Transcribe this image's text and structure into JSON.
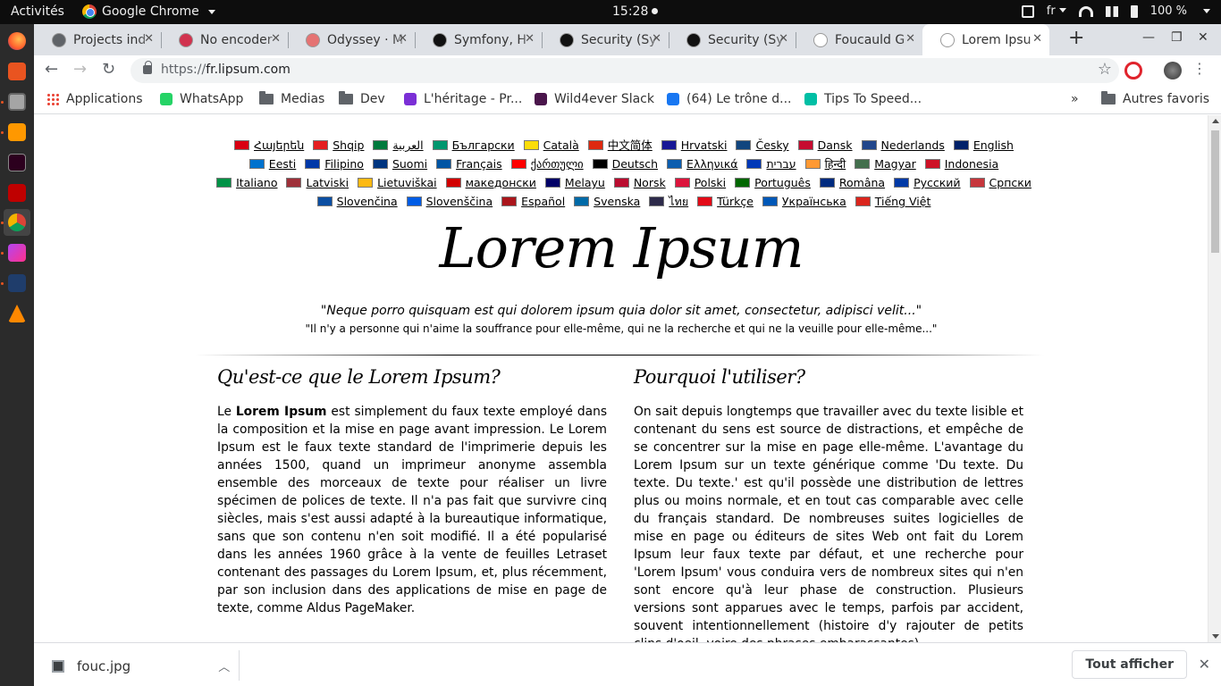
{
  "system": {
    "activities": "Activités",
    "app_name": "Google Chrome",
    "clock": "15:28",
    "keyboard_layout": "fr",
    "battery": "100 %"
  },
  "tabs": [
    {
      "title": "Projects ind",
      "favicon_color": "#5f6368",
      "active": false
    },
    {
      "title": "No encoder",
      "favicon_color": "#d1334f",
      "active": false
    },
    {
      "title": "Odyssey · M",
      "favicon_color": "#e57373",
      "active": false
    },
    {
      "title": "Symfony, H",
      "favicon_color": "#111111",
      "active": false
    },
    {
      "title": "Security (Sy",
      "favicon_color": "#111111",
      "active": false
    },
    {
      "title": "Security (Sy",
      "favicon_color": "#111111",
      "active": false
    },
    {
      "title": "Foucauld G",
      "favicon_color": "#ffffff",
      "active": false
    },
    {
      "title": "Lorem Ipsu",
      "favicon_color": "#ffffff",
      "active": true
    }
  ],
  "omnibox": {
    "scheme": "https://",
    "host": "fr.lipsum.com"
  },
  "bookmarks": [
    {
      "label": "Applications",
      "type": "apps"
    },
    {
      "label": "WhatsApp",
      "type": "site",
      "color": "#25d366"
    },
    {
      "label": "Medias",
      "type": "folder"
    },
    {
      "label": "Dev",
      "type": "folder"
    },
    {
      "label": "L'héritage - Pr...",
      "type": "site",
      "color": "#7b2fd6"
    },
    {
      "label": "Wild4ever Slack",
      "type": "site",
      "color": "#4a154b"
    },
    {
      "label": "(64) Le trône d...",
      "type": "site",
      "color": "#1877f2"
    },
    {
      "label": "Tips To Speed...",
      "type": "site",
      "color": "#00bfa5"
    }
  ],
  "bookmarks_other": "Autres favoris",
  "languages": [
    {
      "label": "Հայերեն",
      "flag": "#d90012"
    },
    {
      "label": "Shqip",
      "flag": "#e41e20"
    },
    {
      "label": "العربية",
      "flag": "#007a3d"
    },
    {
      "label": "Български",
      "flag": "#00966e"
    },
    {
      "label": "Català",
      "flag": "#fcdd09"
    },
    {
      "label": "中文简体",
      "flag": "#de2910"
    },
    {
      "label": "Hrvatski",
      "flag": "#171796"
    },
    {
      "label": "Česky",
      "flag": "#11457e"
    },
    {
      "label": "Dansk",
      "flag": "#c60c30"
    },
    {
      "label": "Nederlands",
      "flag": "#21468b"
    },
    {
      "label": "English",
      "flag": "#012169"
    },
    {
      "label": "Eesti",
      "flag": "#0072ce"
    },
    {
      "label": "Filipino",
      "flag": "#0038a8"
    },
    {
      "label": "Suomi",
      "flag": "#003580"
    },
    {
      "label": "Français",
      "flag": "#0055a4"
    },
    {
      "label": "ქართული",
      "flag": "#ff0000"
    },
    {
      "label": "Deutsch",
      "flag": "#000000"
    },
    {
      "label": "Ελληνικά",
      "flag": "#0d5eaf"
    },
    {
      "label": "עברית",
      "flag": "#0038b8"
    },
    {
      "label": "हिन्दी",
      "flag": "#ff9933"
    },
    {
      "label": "Magyar",
      "flag": "#436f4d"
    },
    {
      "label": "Indonesia",
      "flag": "#ce1126"
    },
    {
      "label": "Italiano",
      "flag": "#009246"
    },
    {
      "label": "Latviski",
      "flag": "#9e3039"
    },
    {
      "label": "Lietuviškai",
      "flag": "#fdb913"
    },
    {
      "label": "македонски",
      "flag": "#d20000"
    },
    {
      "label": "Melayu",
      "flag": "#010066"
    },
    {
      "label": "Norsk",
      "flag": "#ba0c2f"
    },
    {
      "label": "Polski",
      "flag": "#dc143c"
    },
    {
      "label": "Português",
      "flag": "#006600"
    },
    {
      "label": "Româna",
      "flag": "#002b7f"
    },
    {
      "label": "Pусский",
      "flag": "#0039a6"
    },
    {
      "label": "Српски",
      "flag": "#c6363c"
    },
    {
      "label": "Slovenčina",
      "flag": "#0b4ea2"
    },
    {
      "label": "Slovenščina",
      "flag": "#005ce5"
    },
    {
      "label": "Español",
      "flag": "#aa151b"
    },
    {
      "label": "Svenska",
      "flag": "#006aa7"
    },
    {
      "label": "ไทย",
      "flag": "#2d2a4a"
    },
    {
      "label": "Türkçe",
      "flag": "#e30a17"
    },
    {
      "label": "Українська",
      "flag": "#0057b7"
    },
    {
      "label": "Tiếng Việt",
      "flag": "#da251d"
    }
  ],
  "page": {
    "logo": "Lorem Ipsum",
    "quote_latin": "\"Neque porro quisquam est qui dolorem ipsum quia dolor sit amet, consectetur, adipisci velit...\"",
    "quote_french": "\"Il n'y a personne qui n'aime la souffrance pour elle-même, qui ne la recherche et qui ne la veuille pour elle-même...\"",
    "left_heading": "Qu'est-ce que le Lorem Ipsum?",
    "left_intro": "Le ",
    "left_bold": "Lorem Ipsum",
    "left_body": " est simplement du faux texte employé dans la composition et la mise en page avant impression. Le Lorem Ipsum est le faux texte standard de l'imprimerie depuis les années 1500, quand un imprimeur anonyme assembla ensemble des morceaux de texte pour réaliser un livre spécimen de polices de texte. Il n'a pas fait que survivre cinq siècles, mais s'est aussi adapté à la bureautique informatique, sans que son contenu n'en soit modifié. Il a été popularisé dans les années 1960 grâce à la vente de feuilles Letraset contenant des passages du Lorem Ipsum, et, plus récemment, par son inclusion dans des applications de mise en page de texte, comme Aldus PageMaker.",
    "right_heading": "Pourquoi l'utiliser?",
    "right_body": "On sait depuis longtemps que travailler avec du texte lisible et contenant du sens est source de distractions, et empêche de se concentrer sur la mise en page elle-même. L'avantage du Lorem Ipsum sur un texte générique comme 'Du texte. Du texte. Du texte.' est qu'il possède une distribution de lettres plus ou moins normale, et en tout cas comparable avec celle du français standard. De nombreuses suites logicielles de mise en page ou éditeurs de sites Web ont fait du Lorem Ipsum leur faux texte par défaut, et une recherche pour 'Lorem Ipsum' vous conduira vers de nombreux sites qui n'en sont encore qu'à leur phase de construction. Plusieurs versions sont apparues avec le temps, parfois par accident, souvent intentionnellement (histoire d'y rajouter de petits clins d'oeil, voire des phrases embarassantes)."
  },
  "downloads": {
    "file": "fouc.jpg",
    "show_all": "Tout afficher"
  }
}
